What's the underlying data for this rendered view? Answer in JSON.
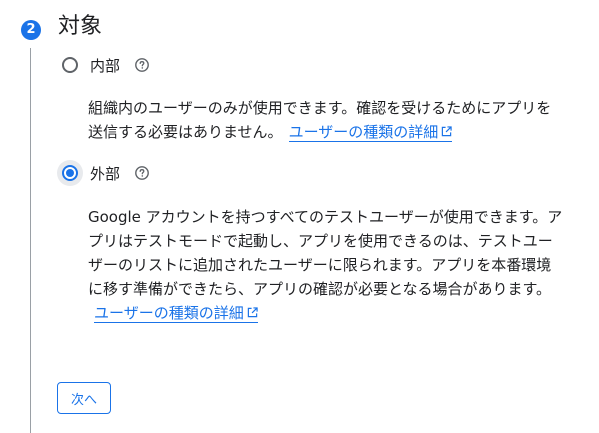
{
  "step": {
    "number": "2",
    "title": "対象"
  },
  "options": [
    {
      "label": "内部",
      "selected": false,
      "description": "組織内のユーザーのみが使用できます。確認を受けるためにアプリを送信する必要はありません。",
      "link_text": "ユーザーの種類の詳細"
    },
    {
      "label": "外部",
      "selected": true,
      "description": "Google アカウントを持つすべてのテストユーザーが使用できます。アプリはテストモードで起動し、アプリを使用できるのは、テストユーザーのリストに追加されたユーザーに限られます。アプリを本番環境に移す準備ができたら、アプリの確認が必要となる場合があります。",
      "link_text": "ユーザーの種類の詳細"
    }
  ],
  "next_button_label": "次へ",
  "icons": {
    "help": "help-circle-icon",
    "external": "open-in-new-icon"
  },
  "colors": {
    "accent": "#1a73e8",
    "text": "#202124",
    "line": "#9aa0a6"
  }
}
